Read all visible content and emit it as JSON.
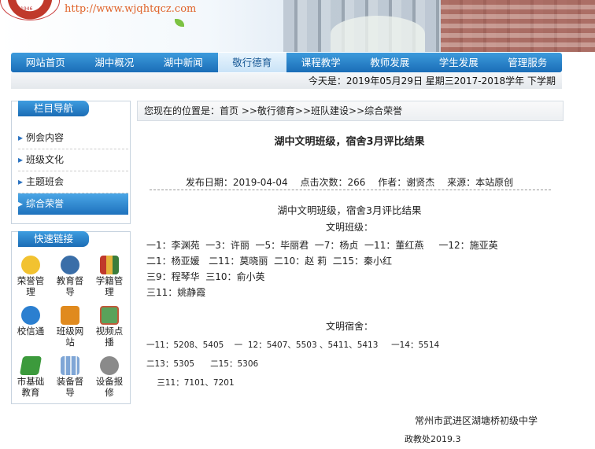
{
  "header": {
    "logo_year": "1946",
    "site_url": "http://www.wjqhtqcz.com"
  },
  "nav": [
    "网站首页",
    "湖中概况",
    "湖中新闻",
    "敬行德育",
    "课程教学",
    "教师发展",
    "学生发展",
    "管理服务"
  ],
  "nav_active": 3,
  "date_bar": "今天是：2019年05月29日 星期三2017-2018学年 下学期",
  "sidebar": {
    "category_title": "栏目导航",
    "categories": [
      "例会内容",
      "班级文化",
      "主题班会",
      "综合荣誉"
    ],
    "active_category": 3,
    "quick_title": "快速链接",
    "quick_links": [
      {
        "label": "荣誉管理",
        "icon": "star-icon",
        "color": "#f2c230"
      },
      {
        "label": "教育督导",
        "icon": "camera-icon",
        "color": "#3a6ea8"
      },
      {
        "label": "学籍管理",
        "icon": "books-icon",
        "color": "#c0392b"
      },
      {
        "label": "校信通",
        "icon": "chat-icon",
        "color": "#2b7fd0"
      },
      {
        "label": "班级网站",
        "icon": "house-icon",
        "color": "#e08a1e"
      },
      {
        "label": "视频点播",
        "icon": "tv-icon",
        "color": "#5aa25a"
      },
      {
        "label": "市基础教育",
        "icon": "map-icon",
        "color": "#3c9a3c"
      },
      {
        "label": "装备督导",
        "icon": "grid-icon",
        "color": "#7fa6d6"
      },
      {
        "label": "设备报修",
        "icon": "gears-icon",
        "color": "#8a8a8a"
      }
    ]
  },
  "breadcrumb": "您现在的位置是：首页 >>敬行德育>>班队建设>>综合荣誉",
  "article": {
    "title": "湖中文明班级，宿舍3月评比结果",
    "meta": {
      "date": "发布日期：2019-04-04",
      "views": "点击次数：266",
      "author": "作者：谢贤杰",
      "source": "来源：本站原创"
    },
    "subtitle": "湖中文明班级，宿舍3月评比结果",
    "class_heading": "文明班级：",
    "class_lines": [
      "一1：李渊苑  一3：许丽  一5：毕丽君  一7：杨贞  一11：董红燕     一12：施亚英",
      "二1：杨亚媛   二11：莫晓丽  二10：赵 莉  二15：秦小红",
      "三9：程琴华  三10：俞小英",
      "三11：姚静霞"
    ],
    "dorm_heading": "文明宿舍：",
    "dorm_lines": [
      "一11：5208、5405    一  12：5407、5503 、5411、5413     一14：5514",
      "二13：5305      二15：5306",
      "    三11：7101、7201"
    ],
    "sign_school": "常州市武进区湖塘桥初级中学",
    "sign_dept": "政教处2019.3"
  }
}
